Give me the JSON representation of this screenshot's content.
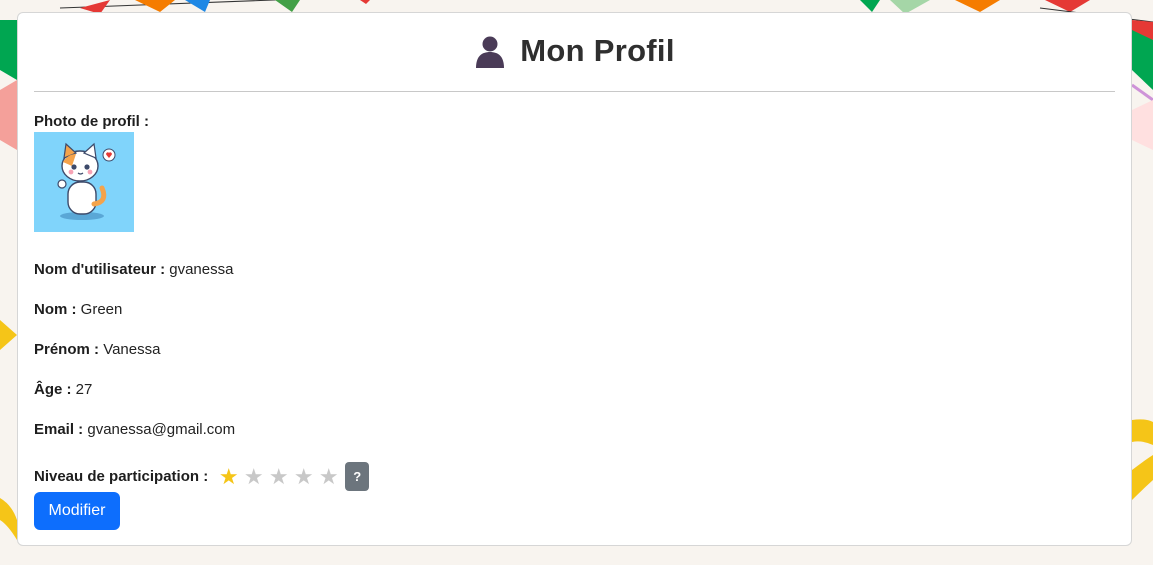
{
  "page": {
    "title": "Mon Profil",
    "title_icon": "user-silhouette-icon"
  },
  "profile": {
    "photo_label": "Photo de profil :",
    "photo_icon": "cat-avatar-illustration",
    "username_label": "Nom d'utilisateur :",
    "username": "gvanessa",
    "lastname_label": "Nom :",
    "lastname": "Green",
    "firstname_label": "Prénom :",
    "firstname": "Vanessa",
    "age_label": "Âge :",
    "age": "27",
    "email_label": "Email :",
    "email": "gvanessa@gmail.com",
    "level_label": "Niveau de participation :",
    "level_value": 1,
    "level_max": 5,
    "help_label": "?"
  },
  "actions": {
    "edit_label": "Modifier"
  },
  "colors": {
    "accent": "#0d6efd",
    "star_on": "#f5c518",
    "star_off": "#c8c8c8",
    "help_button": "#6c757d",
    "avatar_bg": "#80d4fb"
  }
}
